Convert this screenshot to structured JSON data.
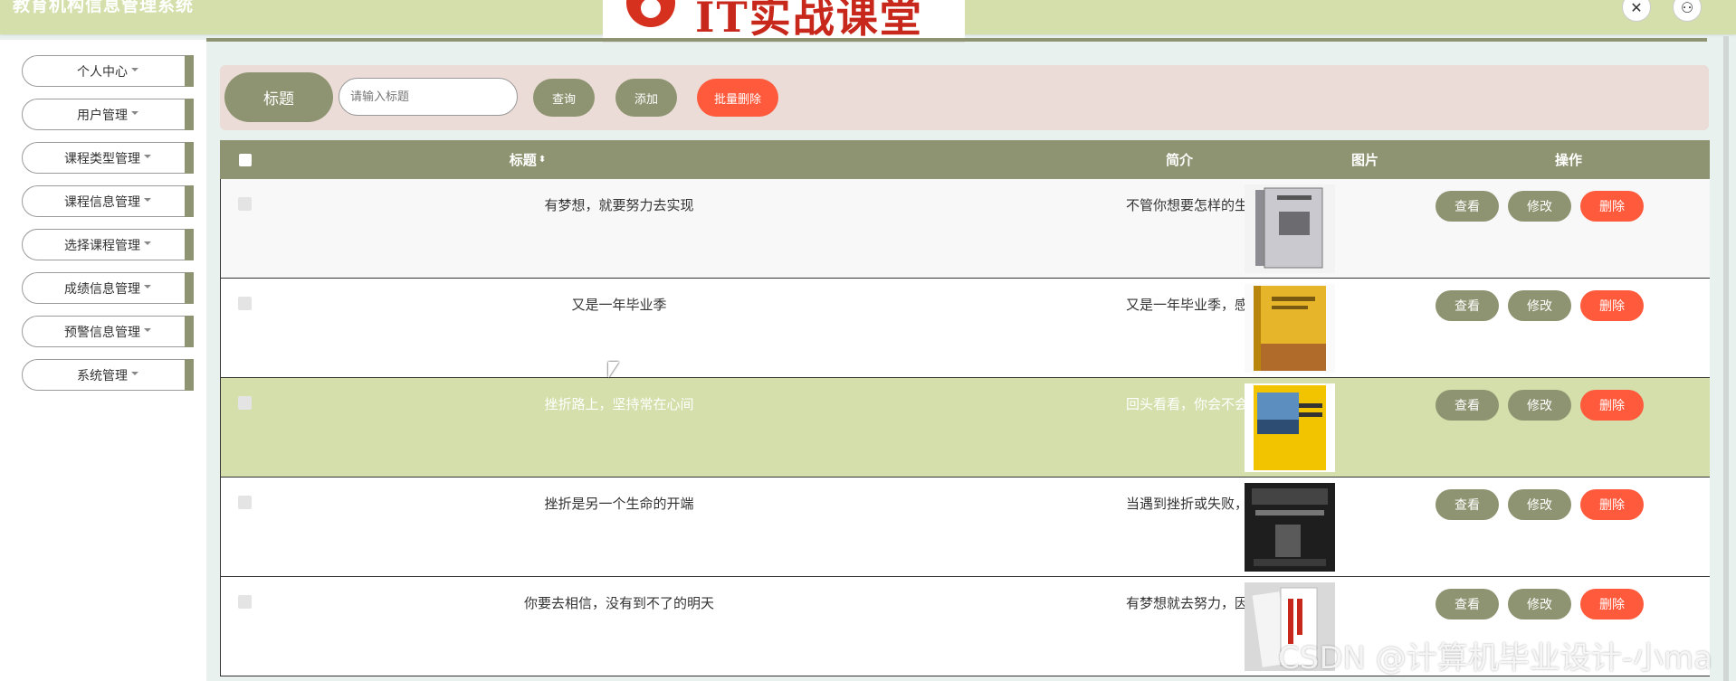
{
  "app": {
    "title": "教育机构信息管理系统",
    "banner_text": "IT实战课堂"
  },
  "top_icons": [
    "close-icon",
    "user-icon"
  ],
  "sidebar": {
    "items": [
      {
        "label": "个人中心"
      },
      {
        "label": "用户管理"
      },
      {
        "label": "课程类型管理"
      },
      {
        "label": "课程信息管理"
      },
      {
        "label": "选择课程管理"
      },
      {
        "label": "成绩信息管理"
      },
      {
        "label": "预警信息管理"
      },
      {
        "label": "系统管理"
      }
    ]
  },
  "search": {
    "label": "标题",
    "placeholder": "请输入标题",
    "query_label": "查询",
    "add_label": "添加",
    "batch_delete_label": "批量删除"
  },
  "table": {
    "headers": {
      "title": "标题",
      "intro": "简介",
      "image": "图片",
      "ops": "操作"
    },
    "rows": [
      {
        "title": "有梦想，就要努力去实现",
        "intro": "不管你想要怎样的生活...",
        "image": "book-cover-grey"
      },
      {
        "title": "又是一年毕业季",
        "intro": "又是一年毕业季，感慨...",
        "image": "book-cover-yellow"
      },
      {
        "title": "挫折路上，坚持常在心间",
        "intro": "回头看看，你会不会发...",
        "image": "book-cover-blue"
      },
      {
        "title": "挫折是另一个生命的开端",
        "intro": "当遇到挫折或失败，你...",
        "image": "book-cover-dark"
      },
      {
        "title": "你要去相信，没有到不了的明天",
        "intro": "有梦想就去努力，因为...",
        "image": "book-cover-red"
      }
    ],
    "ops": {
      "view_label": "查看",
      "edit_label": "修改",
      "delete_label": "删除"
    }
  },
  "watermark": "CSDN @计算机毕业设计-小ma",
  "colors": {
    "header_bg": "#d4dfab",
    "accent": "#8e9471",
    "danger": "#ff5a3c",
    "search_bg": "#ebdcd7",
    "highlight_row": "#d4dfab"
  }
}
